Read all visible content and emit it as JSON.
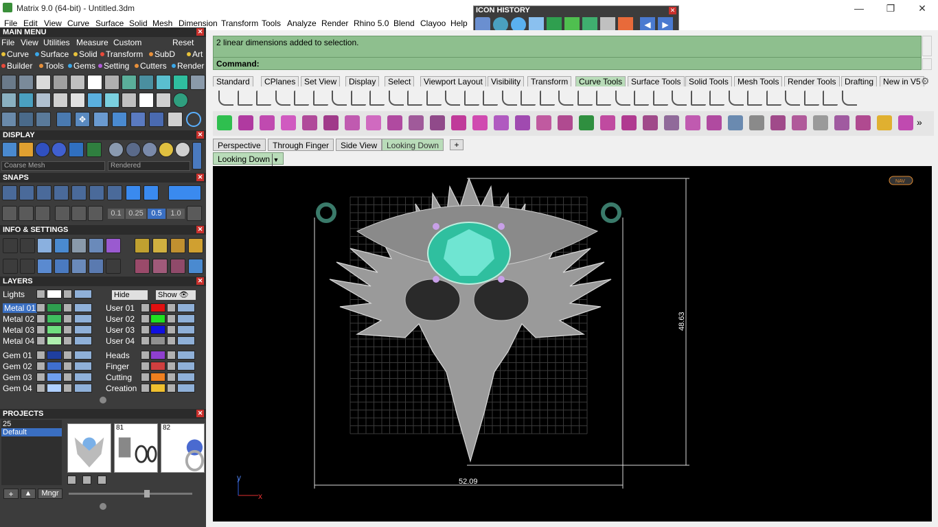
{
  "window": {
    "title": "Matrix 9.0 (64-bit) - Untitled.3dm",
    "minimize": "—",
    "maximize": "❐",
    "close": "✕"
  },
  "menu": [
    "File",
    "Edit",
    "View",
    "Curve",
    "Surface",
    "Solid",
    "Mesh",
    "Dimension",
    "Transform",
    "Tools",
    "Analyze",
    "Render",
    "Rhino 5.0",
    "Blend",
    "Clayoo",
    "Help"
  ],
  "icon_history": {
    "title": "ICON HISTORY"
  },
  "main_menu": {
    "title": "MAIN MENU",
    "row1": [
      "File",
      "View",
      "Utilities",
      "Measure",
      "Custom",
      "Reset"
    ],
    "row2": [
      {
        "label": "Curve",
        "color": "#e8c23a"
      },
      {
        "label": "Surface",
        "color": "#3aa7e8"
      },
      {
        "label": "Solid",
        "color": "#e8c23a"
      },
      {
        "label": "Transform",
        "color": "#e84a3a"
      },
      {
        "label": "SubD",
        "color": "#e8903a"
      },
      {
        "label": "Art",
        "color": "#e8c23a"
      }
    ],
    "row3": [
      {
        "label": "Builder",
        "color": "#e84a3a"
      },
      {
        "label": "Tools",
        "color": "#e8903a"
      },
      {
        "label": "Gems",
        "color": "#3aa7e8"
      },
      {
        "label": "Setting",
        "color": "#b05ad8"
      },
      {
        "label": "Cutters",
        "color": "#e8903a"
      },
      {
        "label": "Render",
        "color": "#3aa7e8"
      }
    ]
  },
  "display": {
    "title": "DISPLAY",
    "mesh_combo": "Coarse Mesh",
    "render_combo": "Rendered"
  },
  "snaps": {
    "title": "SNAPS",
    "values": [
      "0.1",
      "0.25",
      "0.5",
      "1.0"
    ]
  },
  "info": {
    "title": "INFO & SETTINGS"
  },
  "layers": {
    "title": "LAYERS",
    "lights": "Lights",
    "hide": "Hide",
    "show": "Show",
    "left": [
      {
        "name": "Metal 01",
        "color": "#2e9e4f",
        "selected": true
      },
      {
        "name": "Metal 02",
        "color": "#3fbf5f"
      },
      {
        "name": "Metal 03",
        "color": "#6fdf7f"
      },
      {
        "name": "Metal 04",
        "color": "#afefaf"
      },
      {
        "name": "Gem 01",
        "color": "#1f3f9f"
      },
      {
        "name": "Gem 02",
        "color": "#3f6fcf"
      },
      {
        "name": "Gem 03",
        "color": "#6f9fef"
      },
      {
        "name": "Gem 04",
        "color": "#afcfff"
      }
    ],
    "right": [
      {
        "name": "User 01",
        "color": "#e01010"
      },
      {
        "name": "User 02",
        "color": "#20e020"
      },
      {
        "name": "User 03",
        "color": "#1010e0"
      },
      {
        "name": "User 04",
        "color": "#909090"
      },
      {
        "name": "Heads",
        "color": "#8f3fcf"
      },
      {
        "name": "Finger",
        "color": "#cf3f3f"
      },
      {
        "name": "Cutting",
        "color": "#ef7f1f"
      },
      {
        "name": "Creation",
        "color": "#efbf2f"
      }
    ]
  },
  "projects": {
    "title": "PROJECTS",
    "list": [
      "25",
      "Default"
    ],
    "thumbs": [
      "",
      "81",
      "82"
    ],
    "mngr": "Mngr"
  },
  "command": {
    "message": "2 linear dimensions added to selection.",
    "label": "Command:",
    "value": ""
  },
  "toolbar_tabs": [
    "Standard",
    "CPlanes",
    "Set View",
    "Display",
    "Select",
    "Viewport Layout",
    "Visibility",
    "Transform",
    "Curve Tools",
    "Surface Tools",
    "Solid Tools",
    "Mesh Tools",
    "Render Tools",
    "Drafting",
    "New in V5"
  ],
  "active_toolbar_tab": "Curve Tools",
  "viewport_tabs": [
    "Perspective",
    "Through Finger",
    "Side View",
    "Looking Down"
  ],
  "active_viewport_tab": "Looking Down",
  "viewport": {
    "label": "Looking Down",
    "dim_width": "52.09",
    "dim_height": "48.63",
    "axis_y": "y",
    "axis_x": "x",
    "nav_label": "NAV"
  },
  "colors": {
    "gem": "#2fbf9f",
    "metal": "#b8b8b8",
    "panel": "#3c3c3c",
    "command_bg": "#8ebf8e"
  }
}
